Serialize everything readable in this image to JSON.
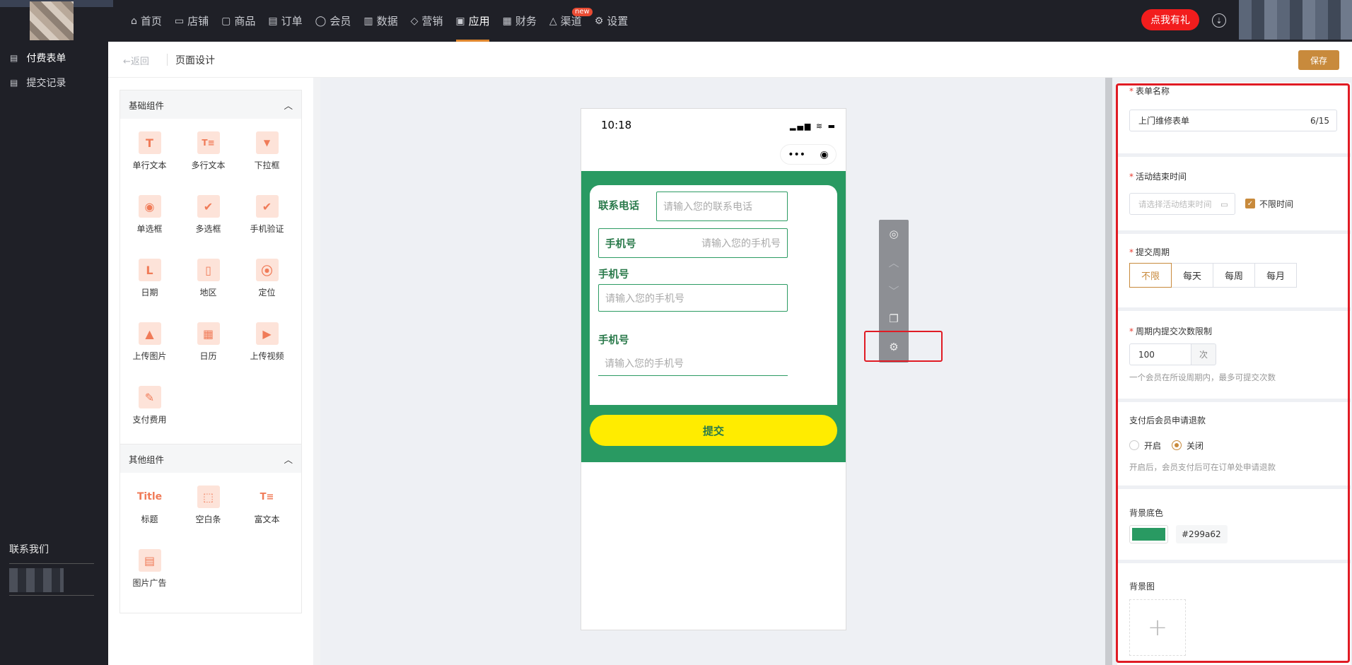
{
  "topnav": {
    "items": [
      {
        "icon": "home-icon",
        "glyph": "⌂",
        "label": "首页"
      },
      {
        "icon": "store-icon",
        "glyph": "▭",
        "label": "店铺"
      },
      {
        "icon": "goods-icon",
        "glyph": "▢",
        "label": "商品"
      },
      {
        "icon": "order-icon",
        "glyph": "▤",
        "label": "订单"
      },
      {
        "icon": "member-icon",
        "glyph": "◯",
        "label": "会员"
      },
      {
        "icon": "data-icon",
        "glyph": "▥",
        "label": "数据"
      },
      {
        "icon": "marketing-icon",
        "glyph": "◇",
        "label": "营销"
      },
      {
        "icon": "apps-icon",
        "glyph": "▣",
        "label": "应用"
      },
      {
        "icon": "finance-icon",
        "glyph": "▦",
        "label": "财务"
      },
      {
        "icon": "channel-icon",
        "glyph": "△",
        "label": "渠道"
      },
      {
        "icon": "settings-icon",
        "glyph": "⚙",
        "label": "设置"
      }
    ],
    "active_index": 7,
    "new_badge": "new",
    "promo_label": "点我有礼",
    "download_glyph": "⇣"
  },
  "sidebar": {
    "items": [
      {
        "label": "付费表单"
      },
      {
        "label": "提交记录"
      }
    ],
    "contact_label": "联系我们"
  },
  "header": {
    "back_label": "←返回",
    "title": "页面设计",
    "save_label": "保存"
  },
  "palette": {
    "basic": {
      "title": "基础组件",
      "items": [
        {
          "label": "单行文本",
          "glyph": "T"
        },
        {
          "label": "多行文本",
          "glyph": "T≡"
        },
        {
          "label": "下拉框",
          "glyph": "▼"
        },
        {
          "label": "单选框",
          "glyph": "◉"
        },
        {
          "label": "多选框",
          "glyph": "✔"
        },
        {
          "label": "手机验证",
          "glyph": "✔"
        },
        {
          "label": "日期",
          "glyph": "L"
        },
        {
          "label": "地区",
          "glyph": "▯"
        },
        {
          "label": "定位",
          "glyph": "⦿"
        },
        {
          "label": "上传图片",
          "glyph": "▲"
        },
        {
          "label": "日历",
          "glyph": "▦"
        },
        {
          "label": "上传视频",
          "glyph": "▶"
        },
        {
          "label": "支付费用",
          "glyph": "✎"
        }
      ]
    },
    "other": {
      "title": "其他组件",
      "items": [
        {
          "label": "标题",
          "glyph": "Title"
        },
        {
          "label": "空白条",
          "glyph": "⬚"
        },
        {
          "label": "富文本",
          "glyph": "T≡"
        },
        {
          "label": "图片广告",
          "glyph": "▤"
        }
      ]
    }
  },
  "phone": {
    "time": "10:18",
    "signal": "▂▄▆ ≋ ▬",
    "capsule_more": "•••",
    "capsule_close": "◉",
    "fields": [
      {
        "label": "联系电话",
        "placeholder": "请输入您的联系电话"
      },
      {
        "label": "手机号",
        "placeholder": "请输入您的手机号"
      },
      {
        "label": "手机号",
        "placeholder": "请输入您的手机号"
      },
      {
        "label": "手机号",
        "placeholder": "请输入您的手机号"
      }
    ],
    "submit_label": "提交"
  },
  "floating_toolbar": {
    "items": [
      {
        "icon": "hide-icon",
        "glyph": "◎"
      },
      {
        "icon": "move-up-icon",
        "glyph": "︿"
      },
      {
        "icon": "move-down-icon",
        "glyph": "﹀"
      },
      {
        "icon": "copy-icon",
        "glyph": "❐"
      },
      {
        "icon": "settings-icon",
        "glyph": "⚙"
      }
    ]
  },
  "panel": {
    "form_name": {
      "label": "表单名称",
      "value": "上门维修表单",
      "count": "6/15"
    },
    "end_time": {
      "label": "活动结束时间",
      "placeholder": "请选择活动结束时间",
      "calendar_glyph": "▭",
      "unlimited_label": "不限时间",
      "unlimited_checked": true
    },
    "period": {
      "label": "提交周期",
      "options": [
        "不限",
        "每天",
        "每周",
        "每月"
      ],
      "selected": 0
    },
    "limit": {
      "label": "周期内提交次数限制",
      "value": "100",
      "unit": "次",
      "hint": "一个会员在所设周期内，最多可提交次数"
    },
    "refund": {
      "label": "支付后会员申请退款",
      "on_label": "开启",
      "off_label": "关闭",
      "selected": "关闭",
      "hint": "开启后，会员支付后可在订单处申请退款"
    },
    "bg_color": {
      "label": "背景底色",
      "value": "#299a62"
    },
    "bg_image": {
      "label": "背景图",
      "add_glyph": "+"
    }
  }
}
